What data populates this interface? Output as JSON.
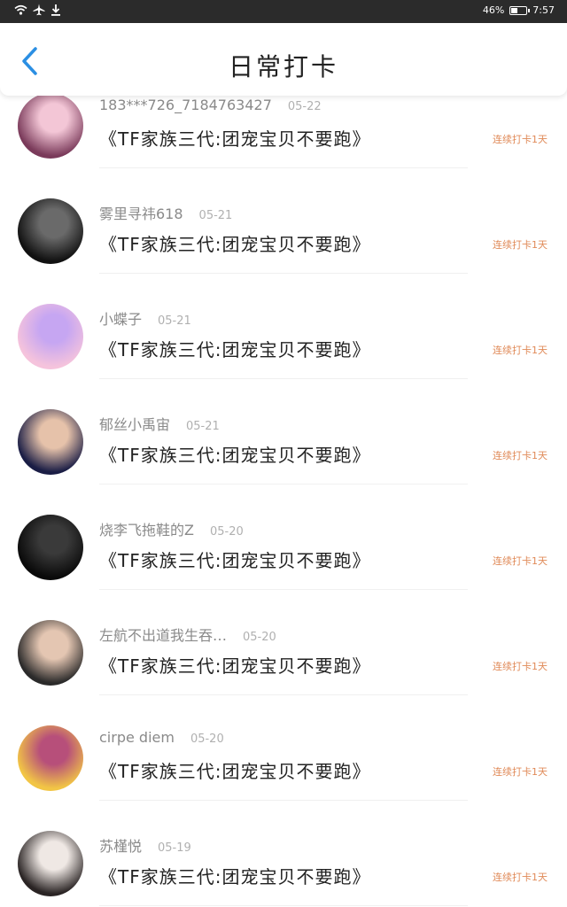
{
  "status_bar": {
    "battery": "46%",
    "battery_level": 0.46,
    "time": "7:57"
  },
  "header": {
    "title": "日常打卡"
  },
  "items": [
    {
      "name": "183***726_7184763427",
      "date": "05-22",
      "text": "《TF家族三代:团宠宝贝不要跑》",
      "streak": "连续打卡1天",
      "avatar": "anime-pink",
      "colors": [
        "#7a3a5a",
        "#f3c6d6"
      ]
    },
    {
      "name": "雾里寻祎618",
      "date": "05-21",
      "text": "《TF家族三代:团宠宝贝不要跑》",
      "streak": "连续打卡1天",
      "avatar": "girl-dark",
      "colors": [
        "#111111",
        "#6a6a6a"
      ]
    },
    {
      "name": "小蝶子",
      "date": "05-21",
      "text": "《TF家族三代:团宠宝贝不要跑》",
      "streak": "连续打卡1天",
      "avatar": "anime-pastel",
      "colors": [
        "#f5c3dc",
        "#c6a6f2"
      ]
    },
    {
      "name": "郁丝小禹宙",
      "date": "05-21",
      "text": "《TF家族三代:团宠宝贝不要跑》",
      "streak": "连续打卡1天",
      "avatar": "boy-portrait",
      "colors": [
        "#1a1d45",
        "#e6c2aa"
      ]
    },
    {
      "name": "烧李飞拖鞋的Z",
      "date": "05-20",
      "text": "《TF家族三代:团宠宝贝不要跑》",
      "streak": "连续打卡1天",
      "avatar": "dark-texture",
      "colors": [
        "#0a0a0a",
        "#3a3a3a"
      ]
    },
    {
      "name": "左航不出道我生吞…",
      "date": "05-20",
      "text": "《TF家族三代:团宠宝贝不要跑》",
      "streak": "连续打卡1天",
      "avatar": "boy-jacket",
      "colors": [
        "#2b2a2a",
        "#e4c6b2"
      ]
    },
    {
      "name": "cirpe diem",
      "date": "05-20",
      "text": "《TF家族三代:团宠宝贝不要跑》",
      "streak": "连续打卡1天",
      "avatar": "anime-blonde",
      "colors": [
        "#f2c545",
        "#b74f7a"
      ]
    },
    {
      "name": "苏槿悦",
      "date": "05-19",
      "text": "《TF家族三代:团宠宝贝不要跑》",
      "streak": "连续打卡1天",
      "avatar": "girl-selfie",
      "colors": [
        "#2a2424",
        "#efe8e4"
      ]
    }
  ]
}
